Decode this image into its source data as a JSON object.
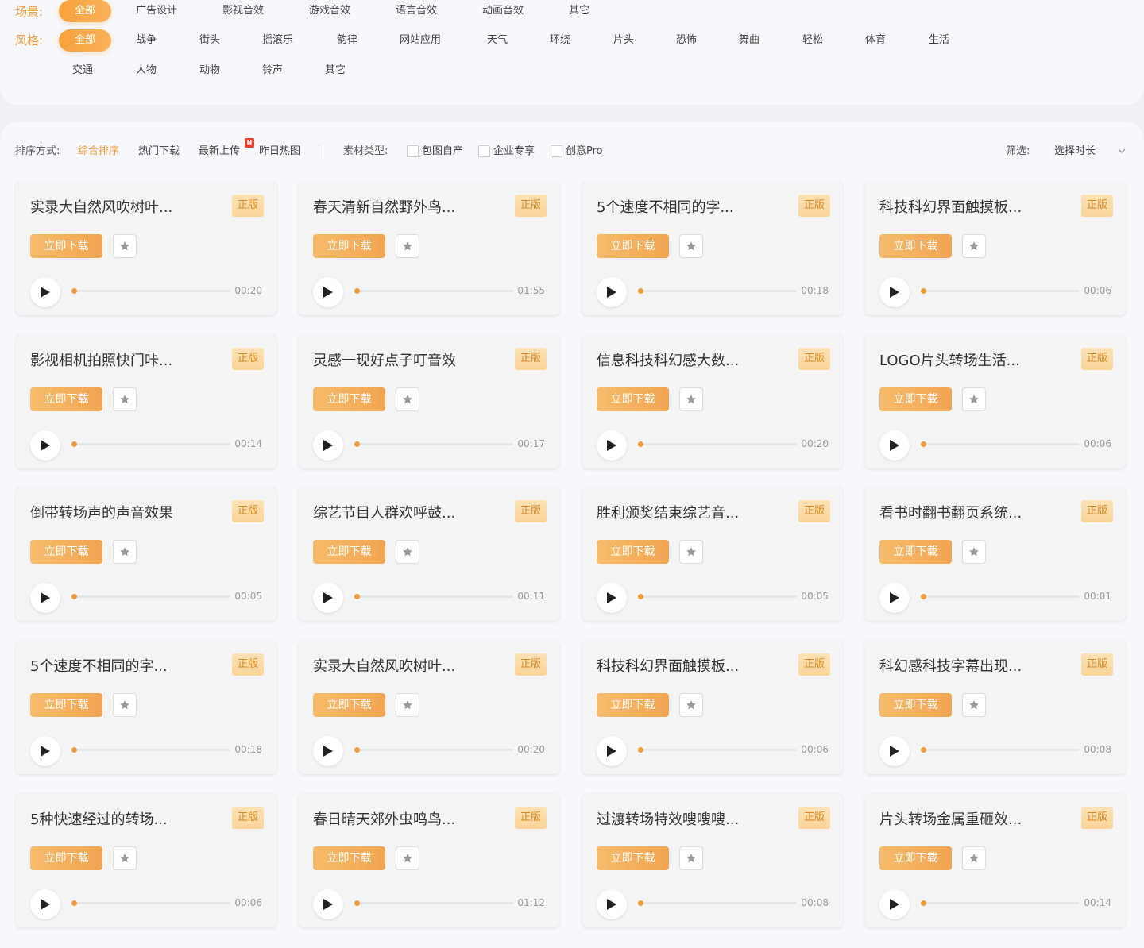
{
  "scene": {
    "label": "场景:",
    "tags": [
      "全部",
      "广告设计",
      "影视音效",
      "游戏音效",
      "语言音效",
      "动画音效",
      "其它"
    ]
  },
  "style": {
    "label": "风格:",
    "tags": [
      "全部",
      "战争",
      "街头",
      "摇滚乐",
      "韵律",
      "网站应用",
      "天气",
      "环绕",
      "片头",
      "恐怖",
      "舞曲",
      "轻松",
      "体育",
      "生活",
      "交通",
      "人物",
      "动物",
      "铃声",
      "其它"
    ]
  },
  "toolbar": {
    "sort_label": "排序方式:",
    "sort_options": [
      "综合排序",
      "热门下载",
      "最新上传",
      "昨日热图"
    ],
    "new_badge": "N",
    "type_label": "素材类型:",
    "type_options": [
      "包图自产",
      "企业专享",
      "创意Pro"
    ],
    "filter_label": "筛选:",
    "duration_select": "选择时长"
  },
  "colors": {
    "accent": "#f29b3a",
    "badge_text": "#d98a25"
  },
  "cards": [
    {
      "title": "实录大自然风吹树叶...",
      "badge": "正版",
      "download": "立即下载",
      "duration": "00:20"
    },
    {
      "title": "春天清新自然野外鸟...",
      "badge": "正版",
      "download": "立即下载",
      "duration": "01:55"
    },
    {
      "title": "5个速度不相同的字...",
      "badge": "正版",
      "download": "立即下载",
      "duration": "00:18"
    },
    {
      "title": "科技科幻界面触摸板...",
      "badge": "正版",
      "download": "立即下载",
      "duration": "00:06"
    },
    {
      "title": "影视相机拍照快门咔...",
      "badge": "正版",
      "download": "立即下载",
      "duration": "00:14"
    },
    {
      "title": "灵感一现好点子叮音效",
      "badge": "正版",
      "download": "立即下载",
      "duration": "00:17"
    },
    {
      "title": "信息科技科幻感大数...",
      "badge": "正版",
      "download": "立即下载",
      "duration": "00:20"
    },
    {
      "title": "LOGO片头转场生活...",
      "badge": "正版",
      "download": "立即下载",
      "duration": "00:06"
    },
    {
      "title": "倒带转场声的声音效果",
      "badge": "正版",
      "download": "立即下载",
      "duration": "00:05"
    },
    {
      "title": "综艺节目人群欢呼鼓...",
      "badge": "正版",
      "download": "立即下载",
      "duration": "00:11"
    },
    {
      "title": "胜利颁奖结束综艺音...",
      "badge": "正版",
      "download": "立即下载",
      "duration": "00:05"
    },
    {
      "title": "看书时翻书翻页系统...",
      "badge": "正版",
      "download": "立即下载",
      "duration": "00:01"
    },
    {
      "title": "5个速度不相同的字...",
      "badge": "正版",
      "download": "立即下载",
      "duration": "00:18"
    },
    {
      "title": "实录大自然风吹树叶...",
      "badge": "正版",
      "download": "立即下载",
      "duration": "00:20"
    },
    {
      "title": "科技科幻界面触摸板...",
      "badge": "正版",
      "download": "立即下载",
      "duration": "00:06"
    },
    {
      "title": "科幻感科技字幕出现...",
      "badge": "正版",
      "download": "立即下载",
      "duration": "00:08"
    },
    {
      "title": "5种快速经过的转场...",
      "badge": "正版",
      "download": "立即下载",
      "duration": "00:06"
    },
    {
      "title": "春日晴天郊外虫鸣鸟...",
      "badge": "正版",
      "download": "立即下载",
      "duration": "01:12"
    },
    {
      "title": "过渡转场特效嗖嗖嗖...",
      "badge": "正版",
      "download": "立即下载",
      "duration": "00:08"
    },
    {
      "title": "片头转场金属重砸效...",
      "badge": "正版",
      "download": "立即下载",
      "duration": "00:14"
    }
  ]
}
